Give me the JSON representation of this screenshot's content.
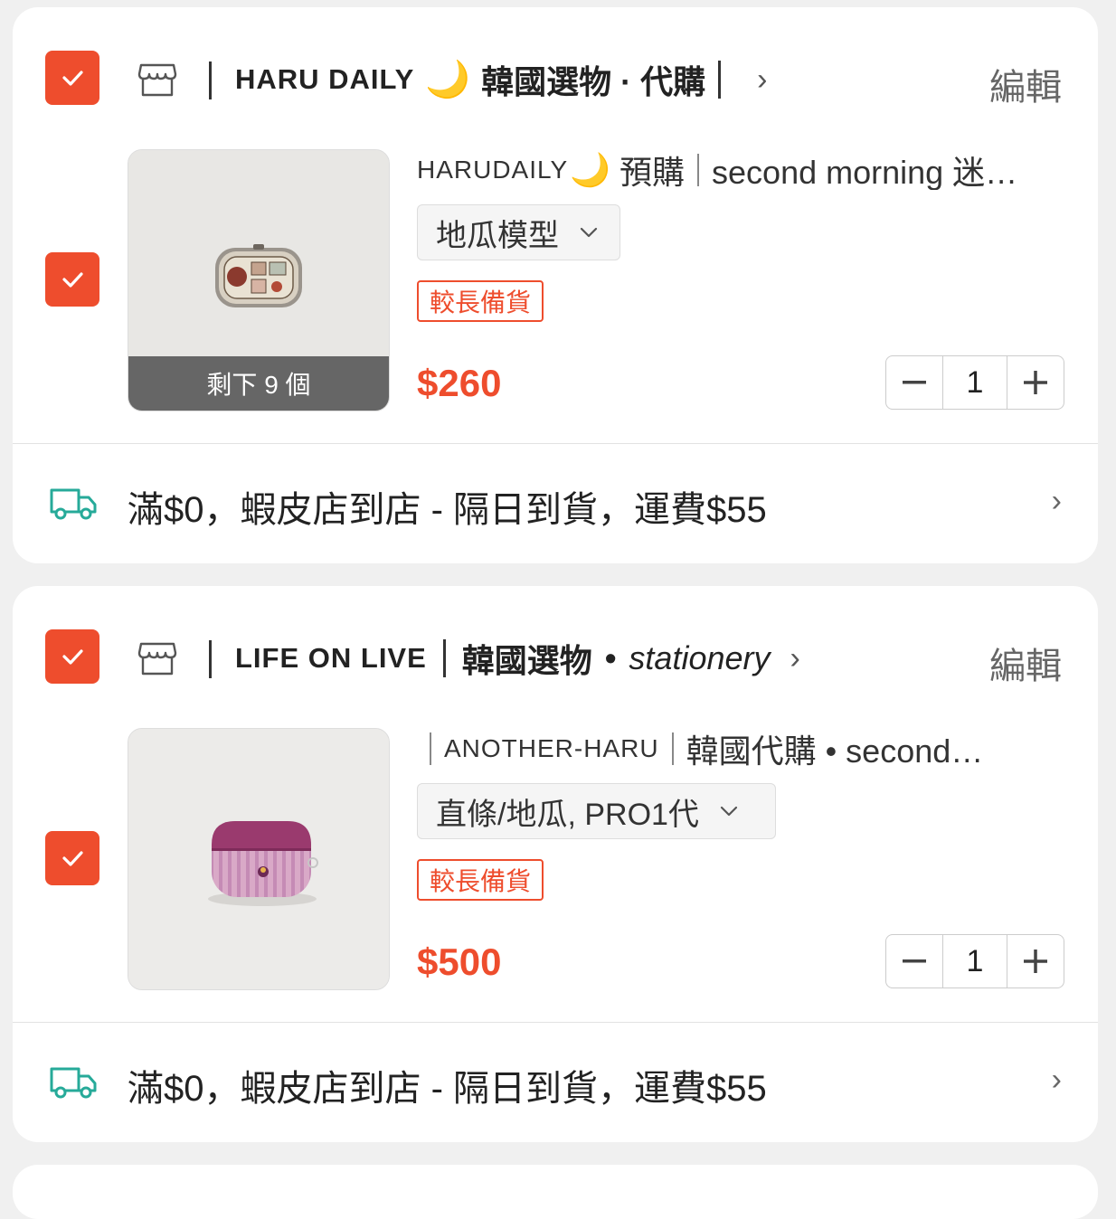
{
  "shops": [
    {
      "name_latin": "HARU DAILY",
      "name_moon": "🌙",
      "name_cjk": "韓國選物 · 代購",
      "edit_label": "編輯",
      "product": {
        "title_brand": "HARUDAILY",
        "title_moon": "🌙",
        "title_rest": "預購",
        "title_tail": "second morning 迷…",
        "variant": "地瓜模型",
        "badge": "較長備貨",
        "stock_label": "剩下 9 個",
        "price": "$260",
        "quantity": "1"
      },
      "shipping": "滿$0，蝦皮店到店 - 隔日到貨，運費$55"
    },
    {
      "name_latin": "LIFE ON LIVE",
      "name_cjk": "韓國選物",
      "name_dot": "•",
      "name_italic": "stationery",
      "edit_label": "編輯",
      "product": {
        "title_brand": "ANOTHER-HARU",
        "title_rest": "韓國代購 • second…",
        "variant": "直條/地瓜, PRO1代",
        "badge": "較長備貨",
        "price": "$500",
        "quantity": "1"
      },
      "shipping": "滿$0，蝦皮店到店 - 隔日到貨，運費$55"
    }
  ],
  "colors": {
    "accent": "#ee4d2d",
    "shipping_icon": "#26aa99"
  },
  "icons": {
    "checkbox": "check-icon",
    "store": "store-icon",
    "shipping": "truck-icon",
    "chevron": "chevron-right-icon"
  }
}
